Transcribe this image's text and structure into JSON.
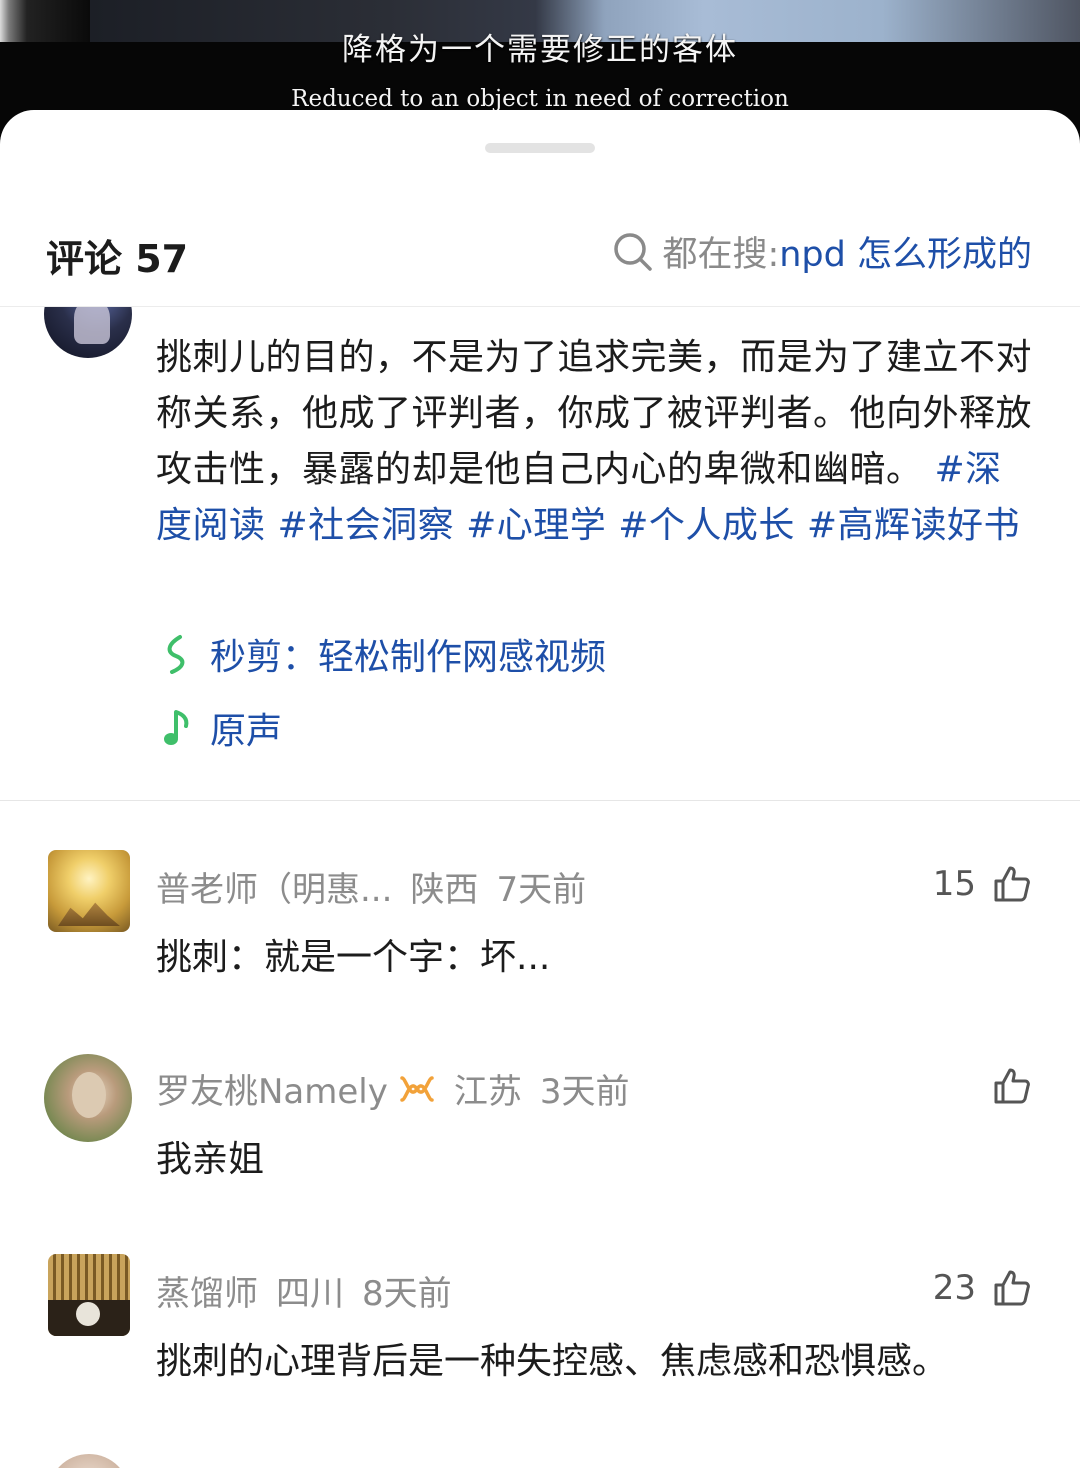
{
  "video": {
    "subtitle_zh": "降格为一个需要修正的客体",
    "subtitle_en": "Reduced to an object in need of correction"
  },
  "header": {
    "title": "评论 57",
    "search_prefix": "都在搜: ",
    "search_query": "npd 怎么形成的",
    "search_icon": "search-icon"
  },
  "post": {
    "text": "挑刺儿的目的，不是为了追求完美，而是为了建立不对称关系，他成了评判者，你成了被评判者。他向外释放攻击性，暴露的却是他自己内心的卑微和幽暗。",
    "tags": [
      "#深度阅读",
      "#社会洞察",
      "#心理学",
      "#个人成长",
      "#高辉读好书"
    ],
    "links": [
      {
        "icon": "miaojian-icon",
        "label": "秒剪：轻松制作网感视频",
        "color": "#3fbf6a"
      },
      {
        "icon": "music-note-icon",
        "label": "原声",
        "color": "#3fbf6a"
      }
    ]
  },
  "comments": [
    {
      "user": "普老师（明惠...",
      "region": "陕西",
      "time": "7天前",
      "likes": "15",
      "text": "挑刺：就是一个字：坏...",
      "badge": ""
    },
    {
      "user": "罗友桃Namely",
      "region": "江苏",
      "time": "3天前",
      "likes": "",
      "text": "我亲姐",
      "badge": "infinity-badge-icon"
    },
    {
      "user": "蒸馏师",
      "region": "四川",
      "time": "8天前",
      "likes": "23",
      "text": "挑刺的心理背后是一种失控感、焦虑感和恐惧感。",
      "badge": ""
    }
  ],
  "colors": {
    "link_blue": "#1e4fa8",
    "meta_gray": "#8c8c8c",
    "green_icon": "#3fbf6a",
    "badge_orange": "#f2a23a"
  }
}
